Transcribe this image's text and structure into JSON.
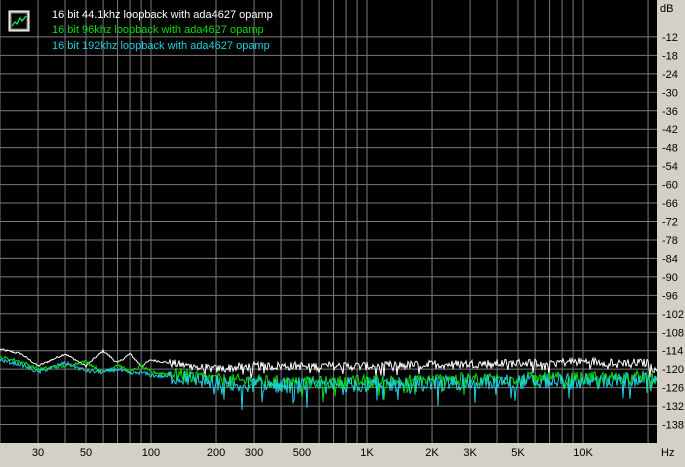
{
  "colors": {
    "background": "#000000",
    "frame": "#d4d0c8",
    "grid": "#7a7a7a",
    "axis_text": "#000000"
  },
  "icons": {
    "legend_toggle": "chart-window-icon"
  },
  "chart_data": {
    "type": "line",
    "title": "",
    "xlabel": "",
    "ylabel": "",
    "x_unit_label": "Hz",
    "y_unit_label": "dB",
    "xscale": "log",
    "xlim": [
      20,
      22000
    ],
    "ylim": [
      -144,
      0
    ],
    "grid": true,
    "legend_placement": "top-left",
    "x_ticks": [
      {
        "value": 30,
        "label": "30"
      },
      {
        "value": 50,
        "label": "50"
      },
      {
        "value": 100,
        "label": "100"
      },
      {
        "value": 200,
        "label": "200"
      },
      {
        "value": 300,
        "label": "300"
      },
      {
        "value": 500,
        "label": "500"
      },
      {
        "value": 1000,
        "label": "1K"
      },
      {
        "value": 2000,
        "label": "2K"
      },
      {
        "value": 3000,
        "label": "3K"
      },
      {
        "value": 5000,
        "label": "5K"
      },
      {
        "value": 10000,
        "label": "10K"
      }
    ],
    "x_minor_grid": [
      20,
      40,
      60,
      70,
      80,
      90,
      400,
      600,
      700,
      800,
      900,
      4000,
      6000,
      7000,
      8000,
      9000,
      20000
    ],
    "y_ticks": [
      -12,
      -18,
      -24,
      -30,
      -36,
      -42,
      -48,
      -54,
      -60,
      -66,
      -72,
      -78,
      -84,
      -90,
      -96,
      -102,
      -108,
      -114,
      -120,
      -126,
      -132,
      -138
    ],
    "series": [
      {
        "name": "16 bit 44.1khz loopback with ada4627 opamp",
        "color": "#ffffff",
        "noise": 1.4,
        "x": [
          20,
          25,
          30,
          40,
          50,
          60,
          70,
          80,
          90,
          100,
          150,
          200,
          300,
          500,
          1000,
          2000,
          5000,
          10000,
          20000,
          22000
        ],
        "y": [
          -113.5,
          -115,
          -119,
          -115,
          -119,
          -114,
          -118,
          -115,
          -119,
          -117,
          -119,
          -120,
          -119,
          -119,
          -119,
          -118.5,
          -118,
          -117.5,
          -118,
          -121
        ]
      },
      {
        "name": "16 bit 96khz loopback with ada4627 opamp",
        "color": "#00e000",
        "noise": 2.2,
        "x": [
          20,
          25,
          30,
          40,
          50,
          60,
          70,
          80,
          90,
          100,
          150,
          200,
          300,
          500,
          1000,
          2000,
          5000,
          10000,
          20000,
          22000
        ],
        "y": [
          -116,
          -117.5,
          -120,
          -119,
          -117.5,
          -121,
          -118.5,
          -121,
          -119,
          -121,
          -122,
          -123.5,
          -124,
          -124.5,
          -124,
          -123.5,
          -123,
          -123,
          -122.5,
          -123
        ]
      },
      {
        "name": "16 bit 192khz loopback with ada4627 opamp",
        "color": "#20d0e0",
        "noise": 2.6,
        "x": [
          20,
          25,
          30,
          40,
          50,
          60,
          70,
          80,
          90,
          100,
          150,
          200,
          300,
          500,
          1000,
          2000,
          5000,
          10000,
          20000,
          22000
        ],
        "y": [
          -117,
          -118.5,
          -121,
          -118,
          -120.5,
          -121,
          -120,
          -121.5,
          -121,
          -122,
          -123,
          -124.5,
          -125,
          -125.5,
          -125,
          -124.5,
          -124,
          -124,
          -123.5,
          -124
        ]
      }
    ]
  }
}
